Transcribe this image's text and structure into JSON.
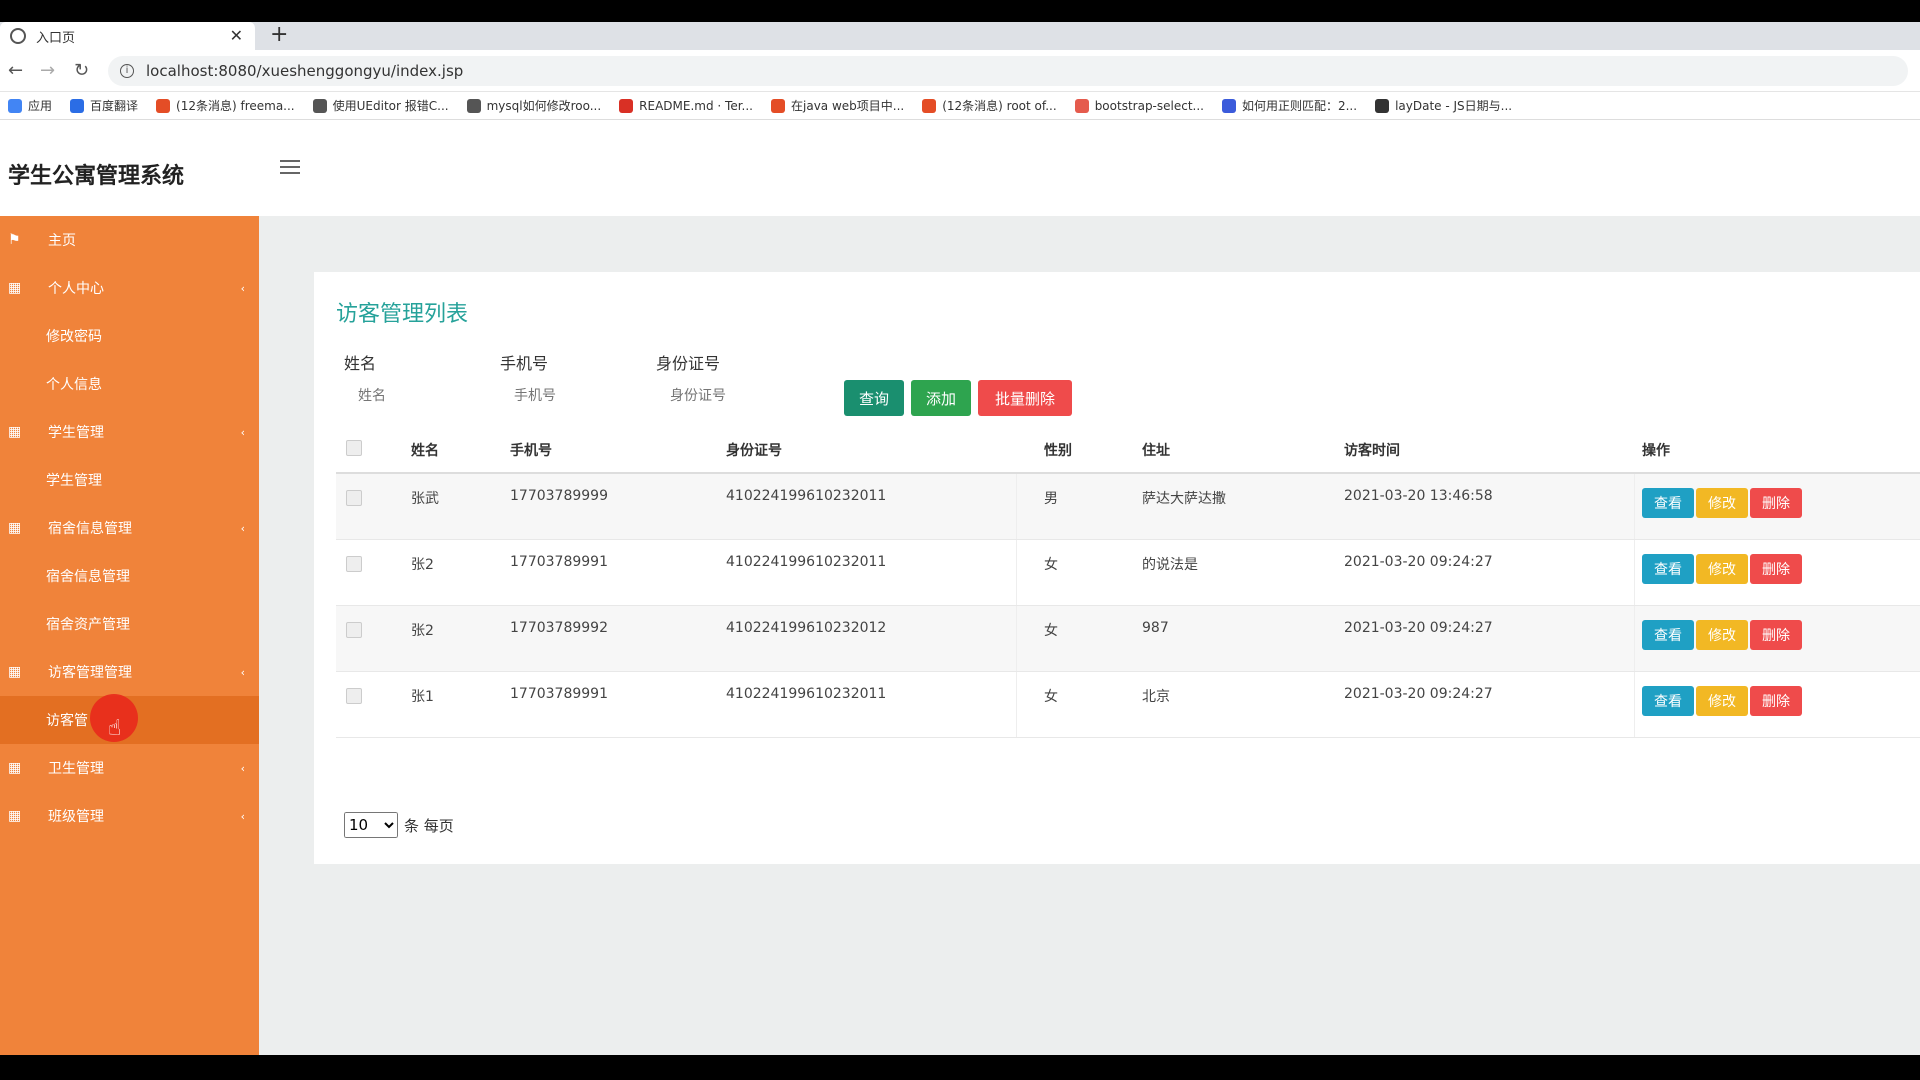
{
  "browser": {
    "tab_title": "入口页",
    "url": "localhost:8080/xueshenggongyu/index.jsp",
    "bookmarks": [
      {
        "label": "应用",
        "color": "#4285f4"
      },
      {
        "label": "百度翻译",
        "color": "#2b6de5"
      },
      {
        "label": "(12条消息) freema...",
        "color": "#e44d26"
      },
      {
        "label": "使用UEditor 报错C...",
        "color": "#555555"
      },
      {
        "label": "mysql如何修改roo...",
        "color": "#555555"
      },
      {
        "label": "README.md · Ter...",
        "color": "#d93025"
      },
      {
        "label": "在java web项目中...",
        "color": "#e44d26"
      },
      {
        "label": "(12条消息) root of...",
        "color": "#e44d26"
      },
      {
        "label": "bootstrap-select...",
        "color": "#e55b4d"
      },
      {
        "label": "如何用正则匹配：2...",
        "color": "#3b5bdb"
      },
      {
        "label": "layDate - JS日期与...",
        "color": "#333333"
      }
    ]
  },
  "app": {
    "title": "学生公寓管理系统"
  },
  "sidebar": {
    "items": [
      {
        "label": "主页",
        "type": "top",
        "icon": "flag-icon"
      },
      {
        "label": "个人中心",
        "type": "group",
        "icon": "grid-icon"
      },
      {
        "label": "修改密码",
        "type": "sub"
      },
      {
        "label": "个人信息",
        "type": "sub"
      },
      {
        "label": "学生管理",
        "type": "group",
        "icon": "grid-icon"
      },
      {
        "label": "学生管理",
        "type": "sub"
      },
      {
        "label": "宿舍信息管理",
        "type": "group",
        "icon": "grid-icon"
      },
      {
        "label": "宿舍信息管理",
        "type": "sub"
      },
      {
        "label": "宿舍资产管理",
        "type": "sub"
      },
      {
        "label": "访客管理管理",
        "type": "group",
        "icon": "grid-icon"
      },
      {
        "label": "访客管",
        "type": "sub",
        "active": true
      },
      {
        "label": "卫生管理",
        "type": "group",
        "icon": "grid-icon"
      },
      {
        "label": "班级管理",
        "type": "group",
        "icon": "grid-icon"
      }
    ]
  },
  "panel": {
    "title": "访客管理列表",
    "search": {
      "name_label": "姓名",
      "name_placeholder": "姓名",
      "phone_label": "手机号",
      "phone_placeholder": "手机号",
      "id_label": "身份证号",
      "id_placeholder": "身份证号",
      "query": "查询",
      "add": "添加",
      "batch_delete": "批量删除"
    },
    "table": {
      "headers": {
        "name": "姓名",
        "phone": "手机号",
        "id": "身份证号",
        "gender": "性别",
        "address": "住址",
        "time": "访客时间",
        "ops": "操作"
      },
      "rows": [
        {
          "name": "张武",
          "phone": "17703789999",
          "id": "410224199610232011",
          "gender": "男",
          "address": "萨达大萨达撒",
          "time": "2021-03-20 13:46:58"
        },
        {
          "name": "张2",
          "phone": "17703789991",
          "id": "410224199610232011",
          "gender": "女",
          "address": "的说法是",
          "time": "2021-03-20 09:24:27"
        },
        {
          "name": "张2",
          "phone": "17703789992",
          "id": "410224199610232012",
          "gender": "女",
          "address": "987",
          "time": "2021-03-20 09:24:27"
        },
        {
          "name": "张1",
          "phone": "17703789991",
          "id": "410224199610232011",
          "gender": "女",
          "address": "北京",
          "time": "2021-03-20 09:24:27"
        }
      ],
      "actions": {
        "view": "查看",
        "edit": "修改",
        "delete": "删除"
      }
    },
    "pager": {
      "page_size": "10",
      "suffix": "条 每页"
    }
  },
  "colors": {
    "sidebar": "#f0833a",
    "title": "#26a29a",
    "query": "#1a8f6f",
    "add": "#2ea44f",
    "danger": "#ef4b4b",
    "view": "#1fa0c4",
    "edit": "#f2b824"
  }
}
